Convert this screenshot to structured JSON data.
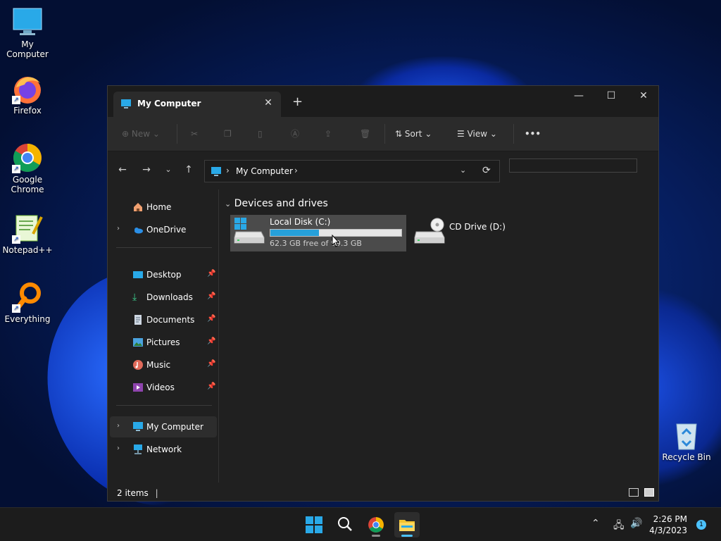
{
  "desktop": {
    "icons": [
      {
        "label": "My Computer",
        "icon": "monitor-icon"
      },
      {
        "label": "Firefox",
        "icon": "firefox-icon"
      },
      {
        "label": "Google Chrome",
        "icon": "chrome-icon"
      },
      {
        "label": "Notepad++",
        "icon": "notepadpp-icon"
      },
      {
        "label": "Everything",
        "icon": "everything-icon"
      },
      {
        "label": "Recycle Bin",
        "icon": "recycle-bin-icon"
      }
    ]
  },
  "window": {
    "tab_title": "My Computer",
    "toolbar": {
      "new_label": "New",
      "sort_label": "Sort",
      "view_label": "View",
      "more_label": "•••"
    },
    "address": {
      "location": "My Computer"
    },
    "sidebar": {
      "items": [
        {
          "label": "Home"
        },
        {
          "label": "OneDrive"
        },
        {
          "label": "Desktop"
        },
        {
          "label": "Downloads"
        },
        {
          "label": "Documents"
        },
        {
          "label": "Pictures"
        },
        {
          "label": "Music"
        },
        {
          "label": "Videos"
        },
        {
          "label": "My Computer"
        },
        {
          "label": "Network"
        }
      ]
    },
    "content": {
      "group_header": "Devices and drives",
      "drives": [
        {
          "name": "Local Disk (C:)",
          "free_text": "62.3 GB free of 99.3 GB",
          "used_fraction": 0.37
        },
        {
          "name": "CD Drive (D:)"
        }
      ]
    },
    "status": {
      "items_text": "2 items"
    }
  },
  "taskbar": {
    "clock_time": "2:26 PM",
    "clock_date": "4/3/2023",
    "notification_count": "1"
  },
  "colors": {
    "accent": "#4cc2ff",
    "drive_bar": "#26a0da"
  }
}
